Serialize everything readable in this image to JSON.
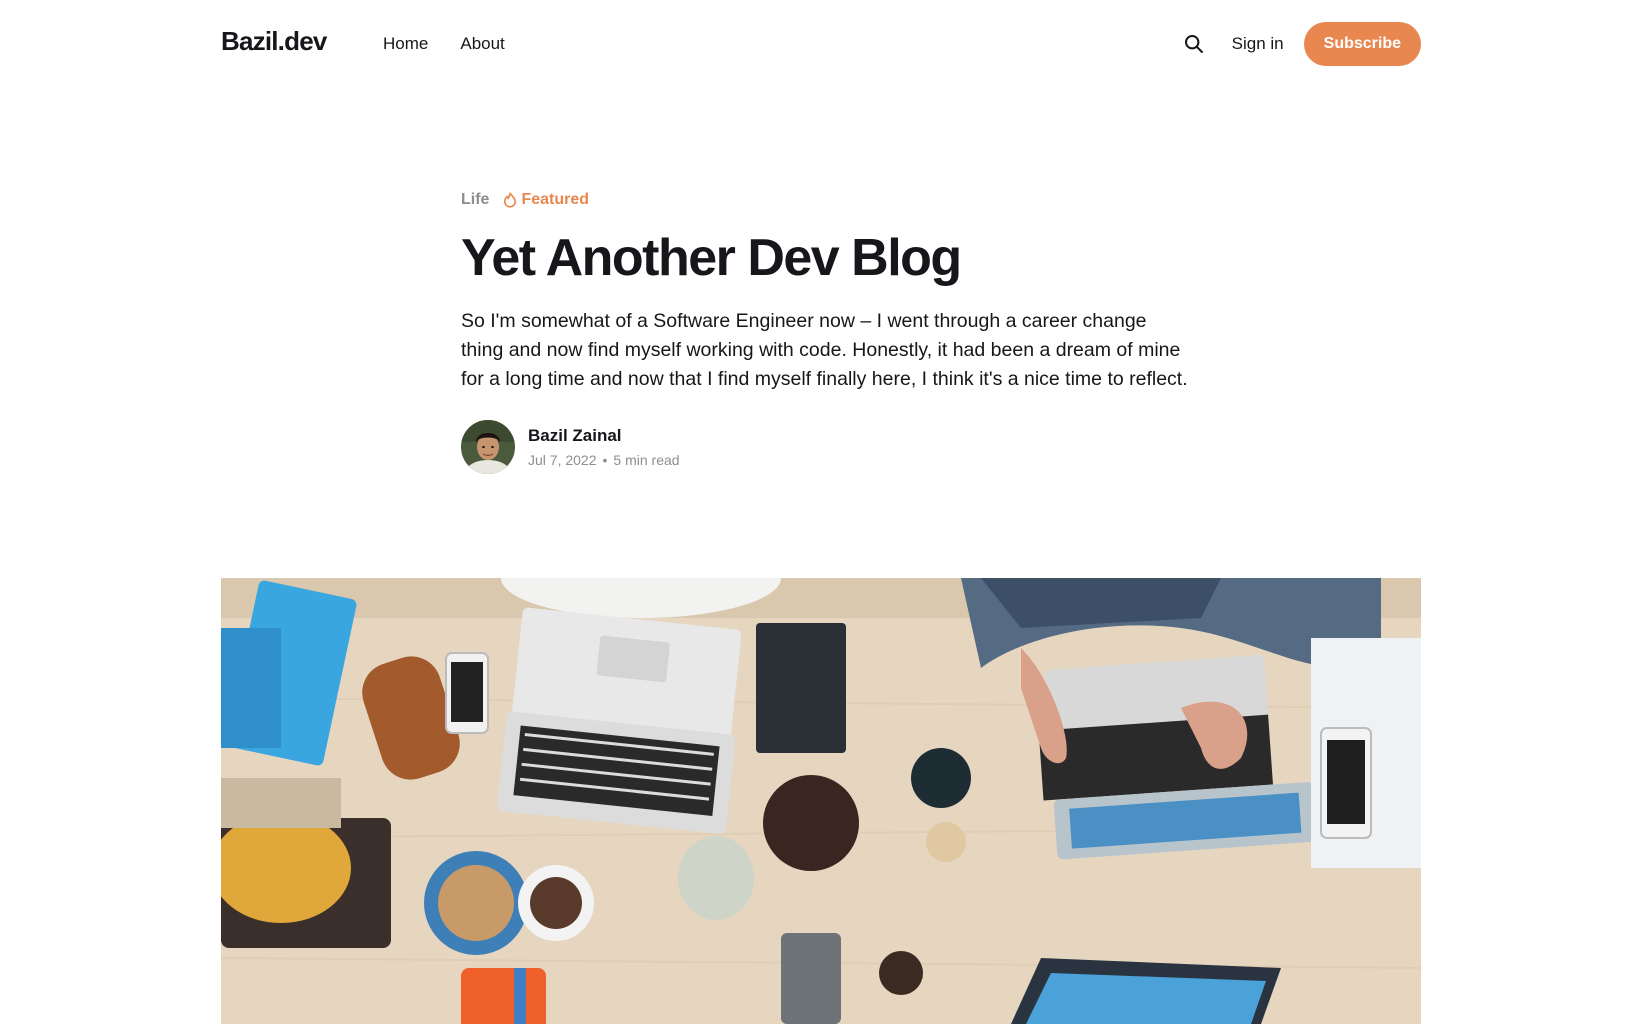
{
  "header": {
    "logo": "Bazil.dev",
    "nav": [
      {
        "label": "Home"
      },
      {
        "label": "About"
      }
    ],
    "search_icon": "search-icon",
    "signin_label": "Sign in",
    "subscribe_label": "Subscribe",
    "accent_color": "#e8874f"
  },
  "article": {
    "tag": "Life",
    "featured_label": "Featured",
    "featured_icon": "flame-icon",
    "title": "Yet Another Dev Blog",
    "excerpt": "So I'm somewhat of a Software Engineer now – I went through a career change thing and now find myself working with code. Honestly, it had been a dream of mine for a long time and now that I find myself finally here, I think it's a nice time to reflect.",
    "author": "Bazil Zainal",
    "date": "Jul 7, 2022",
    "reading_time": "5 min read"
  }
}
